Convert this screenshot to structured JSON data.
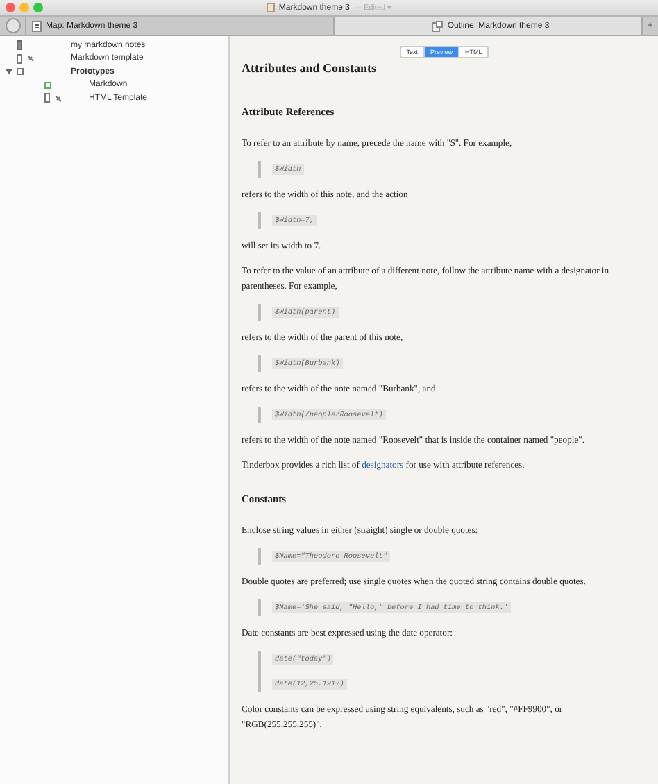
{
  "window": {
    "title": "Markdown theme 3",
    "status": "— Edited ▾"
  },
  "tabs": [
    {
      "label": "Map: Markdown theme 3",
      "selected": false,
      "kind": "map"
    },
    {
      "label": "Outline: Markdown theme 3",
      "selected": true,
      "kind": "outline"
    }
  ],
  "new_tab": "+",
  "outline": [
    {
      "label": "my markdown notes",
      "kind": "note"
    },
    {
      "label": "Markdown template",
      "kind": "template"
    },
    {
      "label": "Prototypes",
      "kind": "container",
      "expanded": true,
      "children": [
        {
          "label": "Markdown",
          "kind": "prototype"
        },
        {
          "label": "HTML Template",
          "kind": "template"
        }
      ]
    }
  ],
  "view_modes": [
    {
      "label": "Text",
      "selected": false
    },
    {
      "label": "Preview",
      "selected": true
    },
    {
      "label": "HTML",
      "selected": false
    }
  ],
  "document": [
    {
      "kind": "h1",
      "text": "Attributes and Constants"
    },
    {
      "kind": "h2",
      "text": "Attribute References"
    },
    {
      "kind": "p",
      "text": "To refer to an attribute by name, precede the name with \"$\". For example,"
    },
    {
      "kind": "code",
      "lines": [
        "$Width"
      ]
    },
    {
      "kind": "p",
      "text": "refers to the width of this note, and the action"
    },
    {
      "kind": "code",
      "lines": [
        "$Width=7;"
      ]
    },
    {
      "kind": "p",
      "text": "will set its width to 7."
    },
    {
      "kind": "p",
      "text": "To refer to the value of an attribute of a different note, follow the attribute name with a designator in parentheses. For example,"
    },
    {
      "kind": "code",
      "lines": [
        "$Width(parent)"
      ]
    },
    {
      "kind": "p",
      "text": "refers to the width of the parent of this note,"
    },
    {
      "kind": "code",
      "lines": [
        "$Width(Burbank)"
      ]
    },
    {
      "kind": "p",
      "text": "refers to the width of the note named \"Burbank\", and"
    },
    {
      "kind": "code",
      "lines": [
        "$Width(/people/Roosevelt)"
      ]
    },
    {
      "kind": "p",
      "text": "refers to the width of the note named \"Roosevelt\" that is inside the container named \"people\"."
    },
    {
      "kind": "link_p",
      "before": "Tinderbox provides a rich list of ",
      "link": "designators",
      "after": " for use with attribute references."
    },
    {
      "kind": "h2",
      "text": "Constants"
    },
    {
      "kind": "p",
      "text": "Enclose string values in either (straight) single or double quotes:"
    },
    {
      "kind": "code",
      "lines": [
        "$Name=\"Theodore Roosevelt\""
      ]
    },
    {
      "kind": "p",
      "text": "Double quotes are preferred; use single quotes when the quoted string contains double quotes."
    },
    {
      "kind": "code",
      "lines": [
        "$Name='She said, \"Hello,\" before I had time to think.'"
      ]
    },
    {
      "kind": "p",
      "text": "Date constants are best expressed using the date operator:"
    },
    {
      "kind": "code",
      "lines": [
        "date(\"today\")",
        "date(12,25,1917)"
      ]
    },
    {
      "kind": "p",
      "text": "Color constants can be expressed using string equivalents, such as \"red\", \"#FF9900\", or \"RGB(255,255,255)\"."
    }
  ]
}
